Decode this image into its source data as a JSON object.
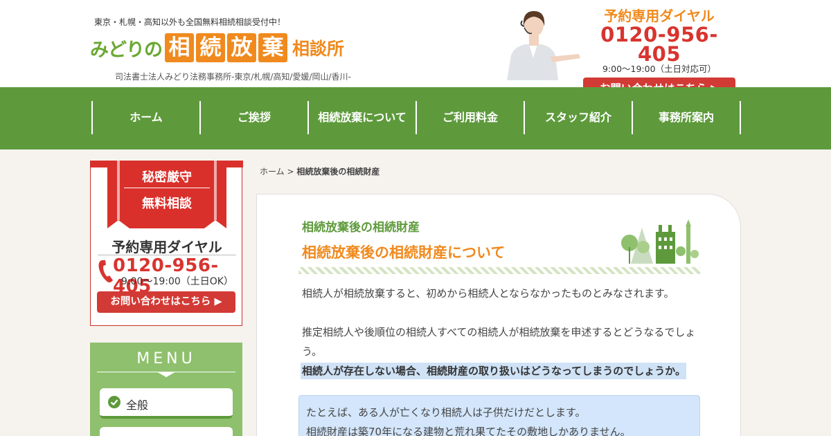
{
  "header": {
    "tagline": "東京・札幌・高知以外も全国無料相続相談受付中！",
    "logo": {
      "prefix": "みどりの",
      "boxed": [
        "相",
        "続",
        "放",
        "棄"
      ],
      "suffix": "相談所"
    },
    "subtitle": "司法書士法人みどり法務事務所-東京/札幌/高知/愛媛/岡山/香川-",
    "dial_label": "予約専用ダイヤル",
    "phone": "0120-956-405",
    "hours": "9:00〜19:00（土日対応可）",
    "contact_button": "お問い合わせはこちら ▶"
  },
  "nav": [
    "ホーム",
    "ご挨拶",
    "相続放棄について",
    "ご利用料金",
    "スタッフ紹介",
    "事務所案内"
  ],
  "sidebar": {
    "ribbon_top": "秘密厳守",
    "ribbon_bottom": "無料相談",
    "dial_label": "予約専用ダイヤル",
    "phone": "0120-956-405",
    "hours": "9:00〜19:00（土日OK）",
    "contact_button": "お問い合わせはこちら ▶",
    "menu_title": "MENU",
    "menu_items": [
      "全般"
    ]
  },
  "breadcrumb": {
    "home": "ホーム",
    "sep": " > ",
    "current": "相続放棄後の相続財産"
  },
  "main": {
    "subheading": "相続放棄後の相続財産",
    "heading": "相続放棄後の相続財産について",
    "p1": "相続人が相続放棄すると、初めから相続人とならなかったものとみなされます。",
    "p2": "推定相続人や後順位の相続人すべての相続人が相続放棄を申述するとどうなるでしょう。",
    "p3": "相続人が存在しない場合、相続財産の取り扱いはどうなってしまうのでしょうか。",
    "note1": "たとえば、ある人が亡くなり相続人は子供だけだとします。",
    "note2": "相続財産は築70年になる建物と荒れ果てたその敷地しかありません。"
  },
  "colors": {
    "green": "#5e9a3c",
    "orange": "#f08a1e",
    "red": "#d23a35",
    "highlight": "#cfe2f6"
  }
}
